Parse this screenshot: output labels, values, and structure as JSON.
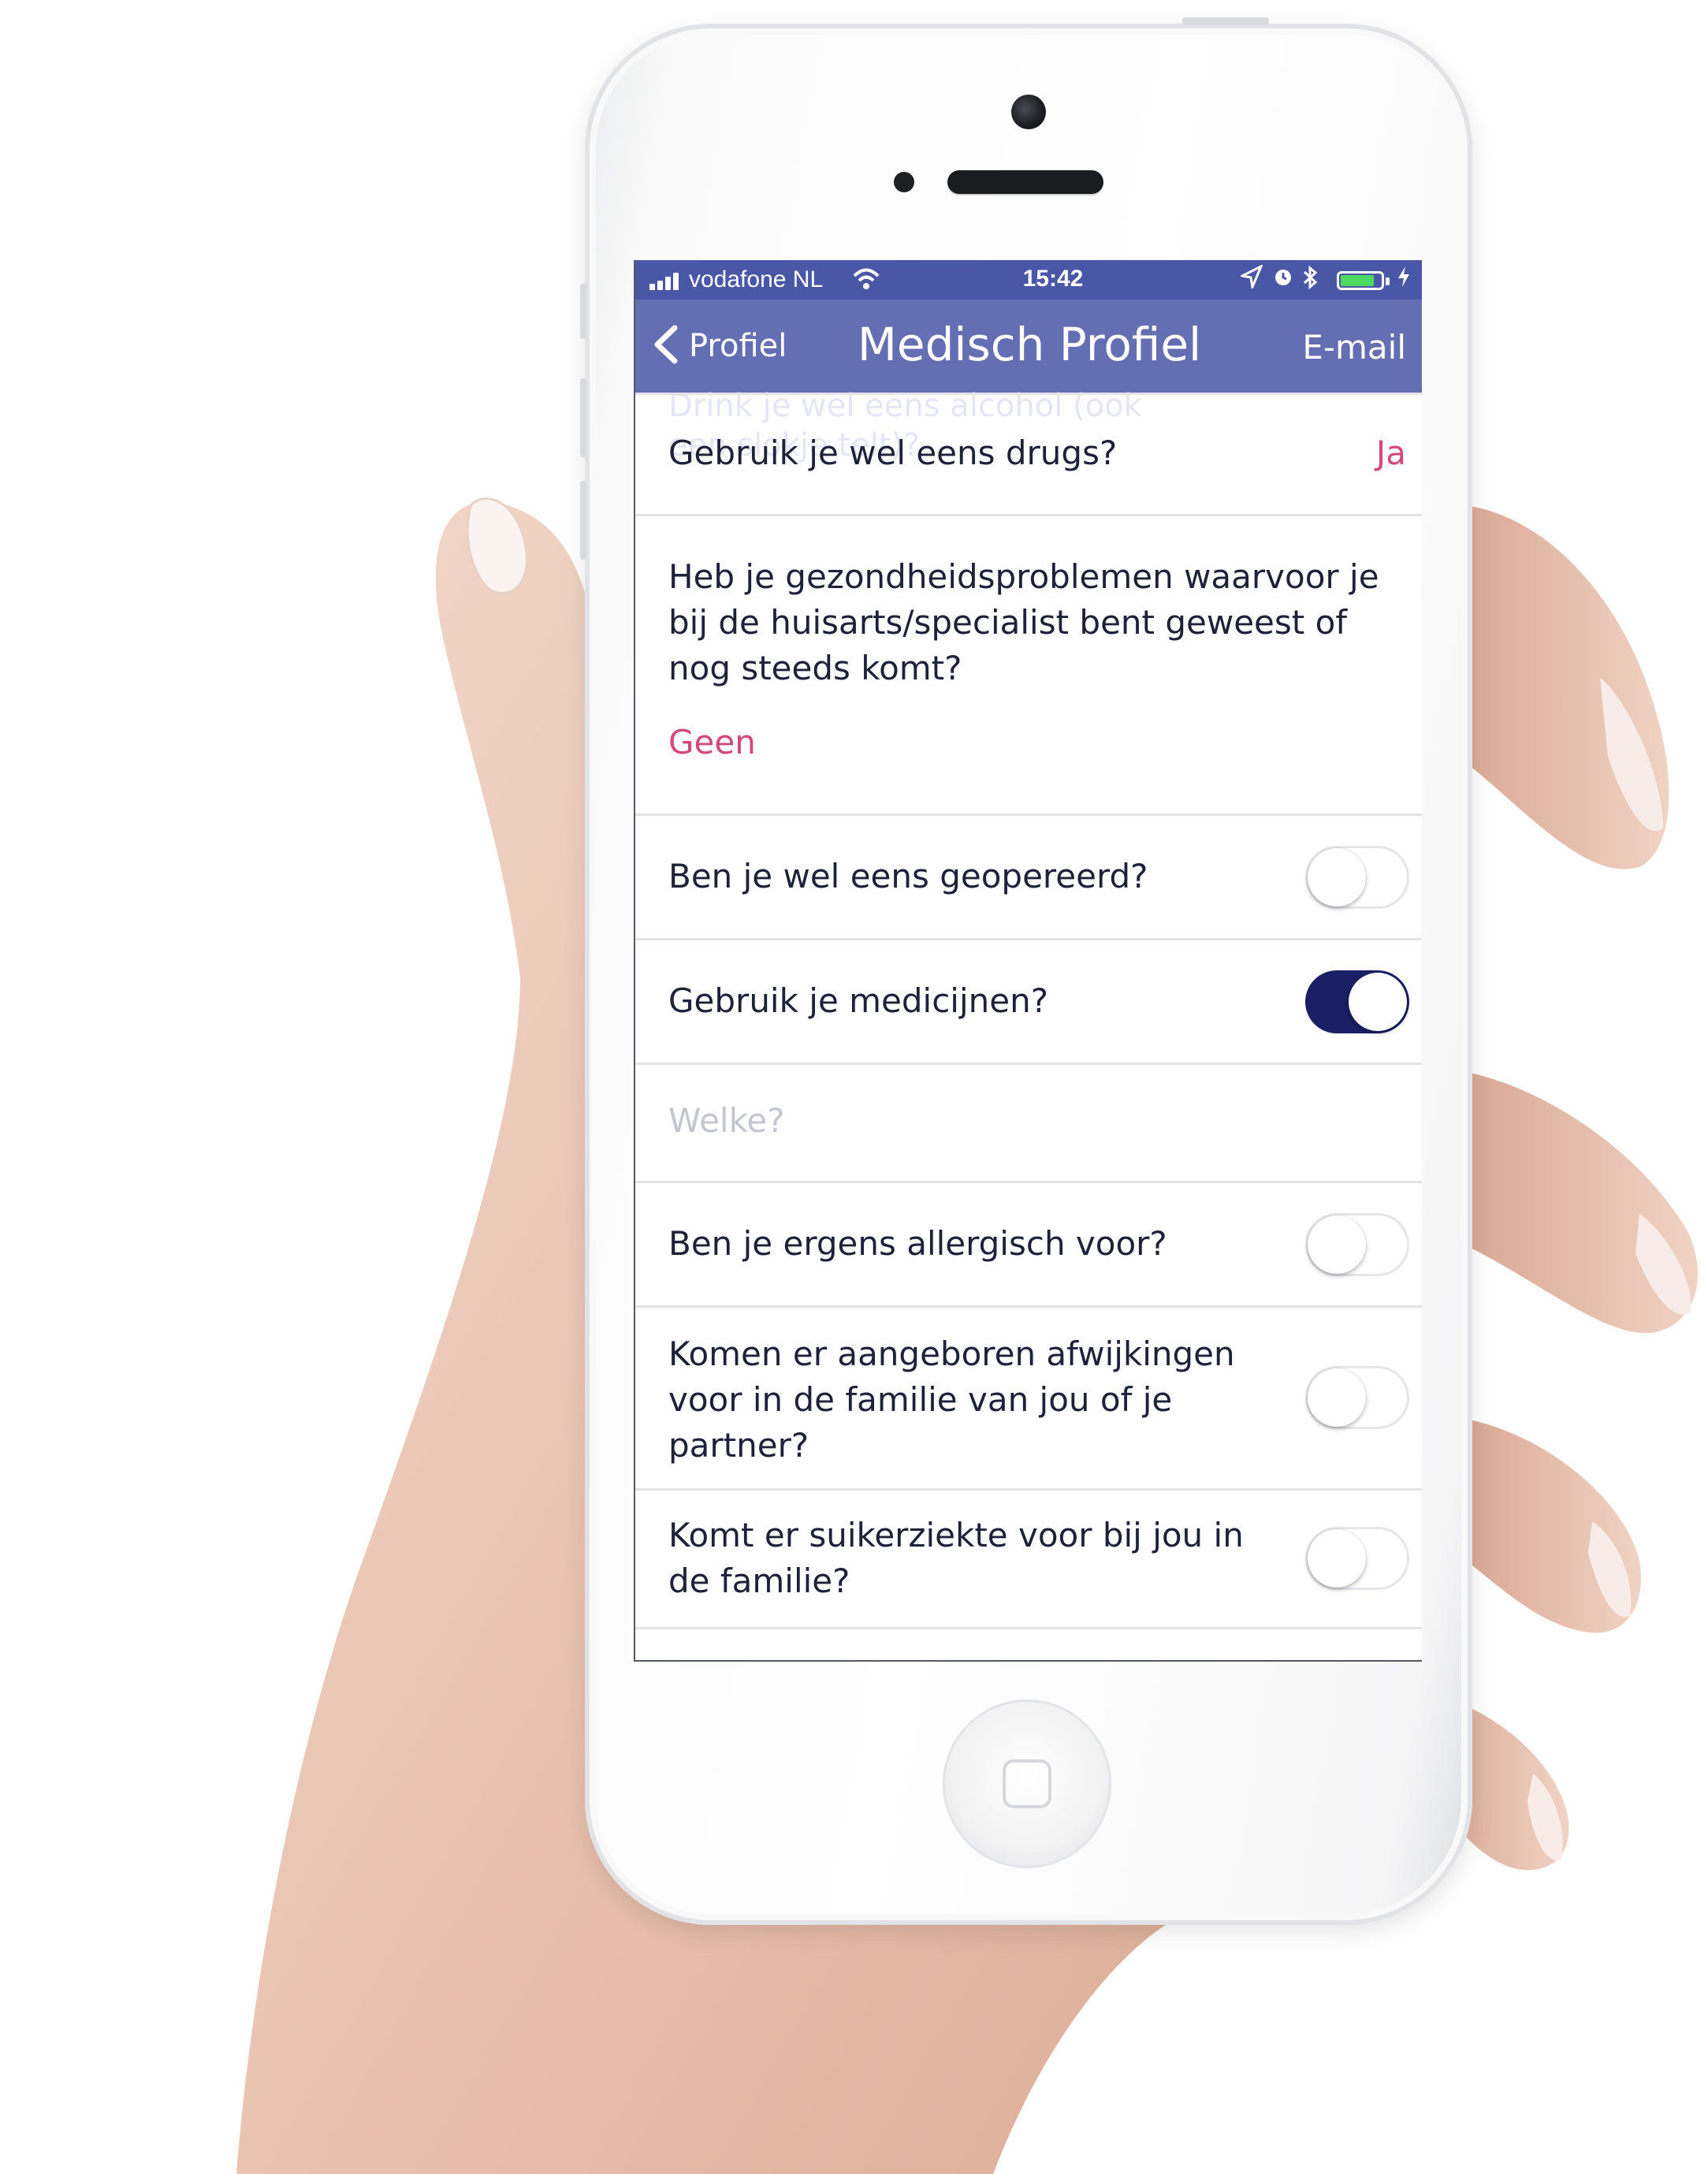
{
  "status_bar": {
    "carrier": "vodafone NL",
    "time": "15:42",
    "battery_level": 0.85,
    "battery_color": "#4cd964"
  },
  "nav_bar": {
    "back_label": "Profiel",
    "title": "Medisch Profiel",
    "right_action": "E-mail",
    "background_color": "#4a56a6"
  },
  "scrolled_behind_text": "Drink je wel eens alcohol (ook een slokje telt)?",
  "rows": {
    "drugs": {
      "question": "Gebruik je wel eens drugs?",
      "value": "Ja"
    },
    "health": {
      "question": "Heb je gezondheidsproblemen waarvoor je bij de huisarts/specialist bent geweest of nog steeds komt?",
      "value": "Geen"
    },
    "surgery": {
      "question": "Ben je wel eens geopereerd?",
      "toggle_on": false
    },
    "medicines": {
      "question": "Gebruik je medicijnen?",
      "toggle_on": true
    },
    "which_medicines": {
      "placeholder": "Welke?"
    },
    "allergy": {
      "question": "Ben je ergens allergisch voor?",
      "toggle_on": false
    },
    "congenital": {
      "question": "Komen er aangeboren afwijkingen voor in de familie van jou of je partner?",
      "toggle_on": false
    },
    "diabetes": {
      "question": "Komt er suikerziekte voor bij jou in de familie?",
      "toggle_on": false
    }
  },
  "colors": {
    "accent": "#d5487a",
    "toggle_on": "#1a1f66",
    "text": "#1e2238"
  }
}
